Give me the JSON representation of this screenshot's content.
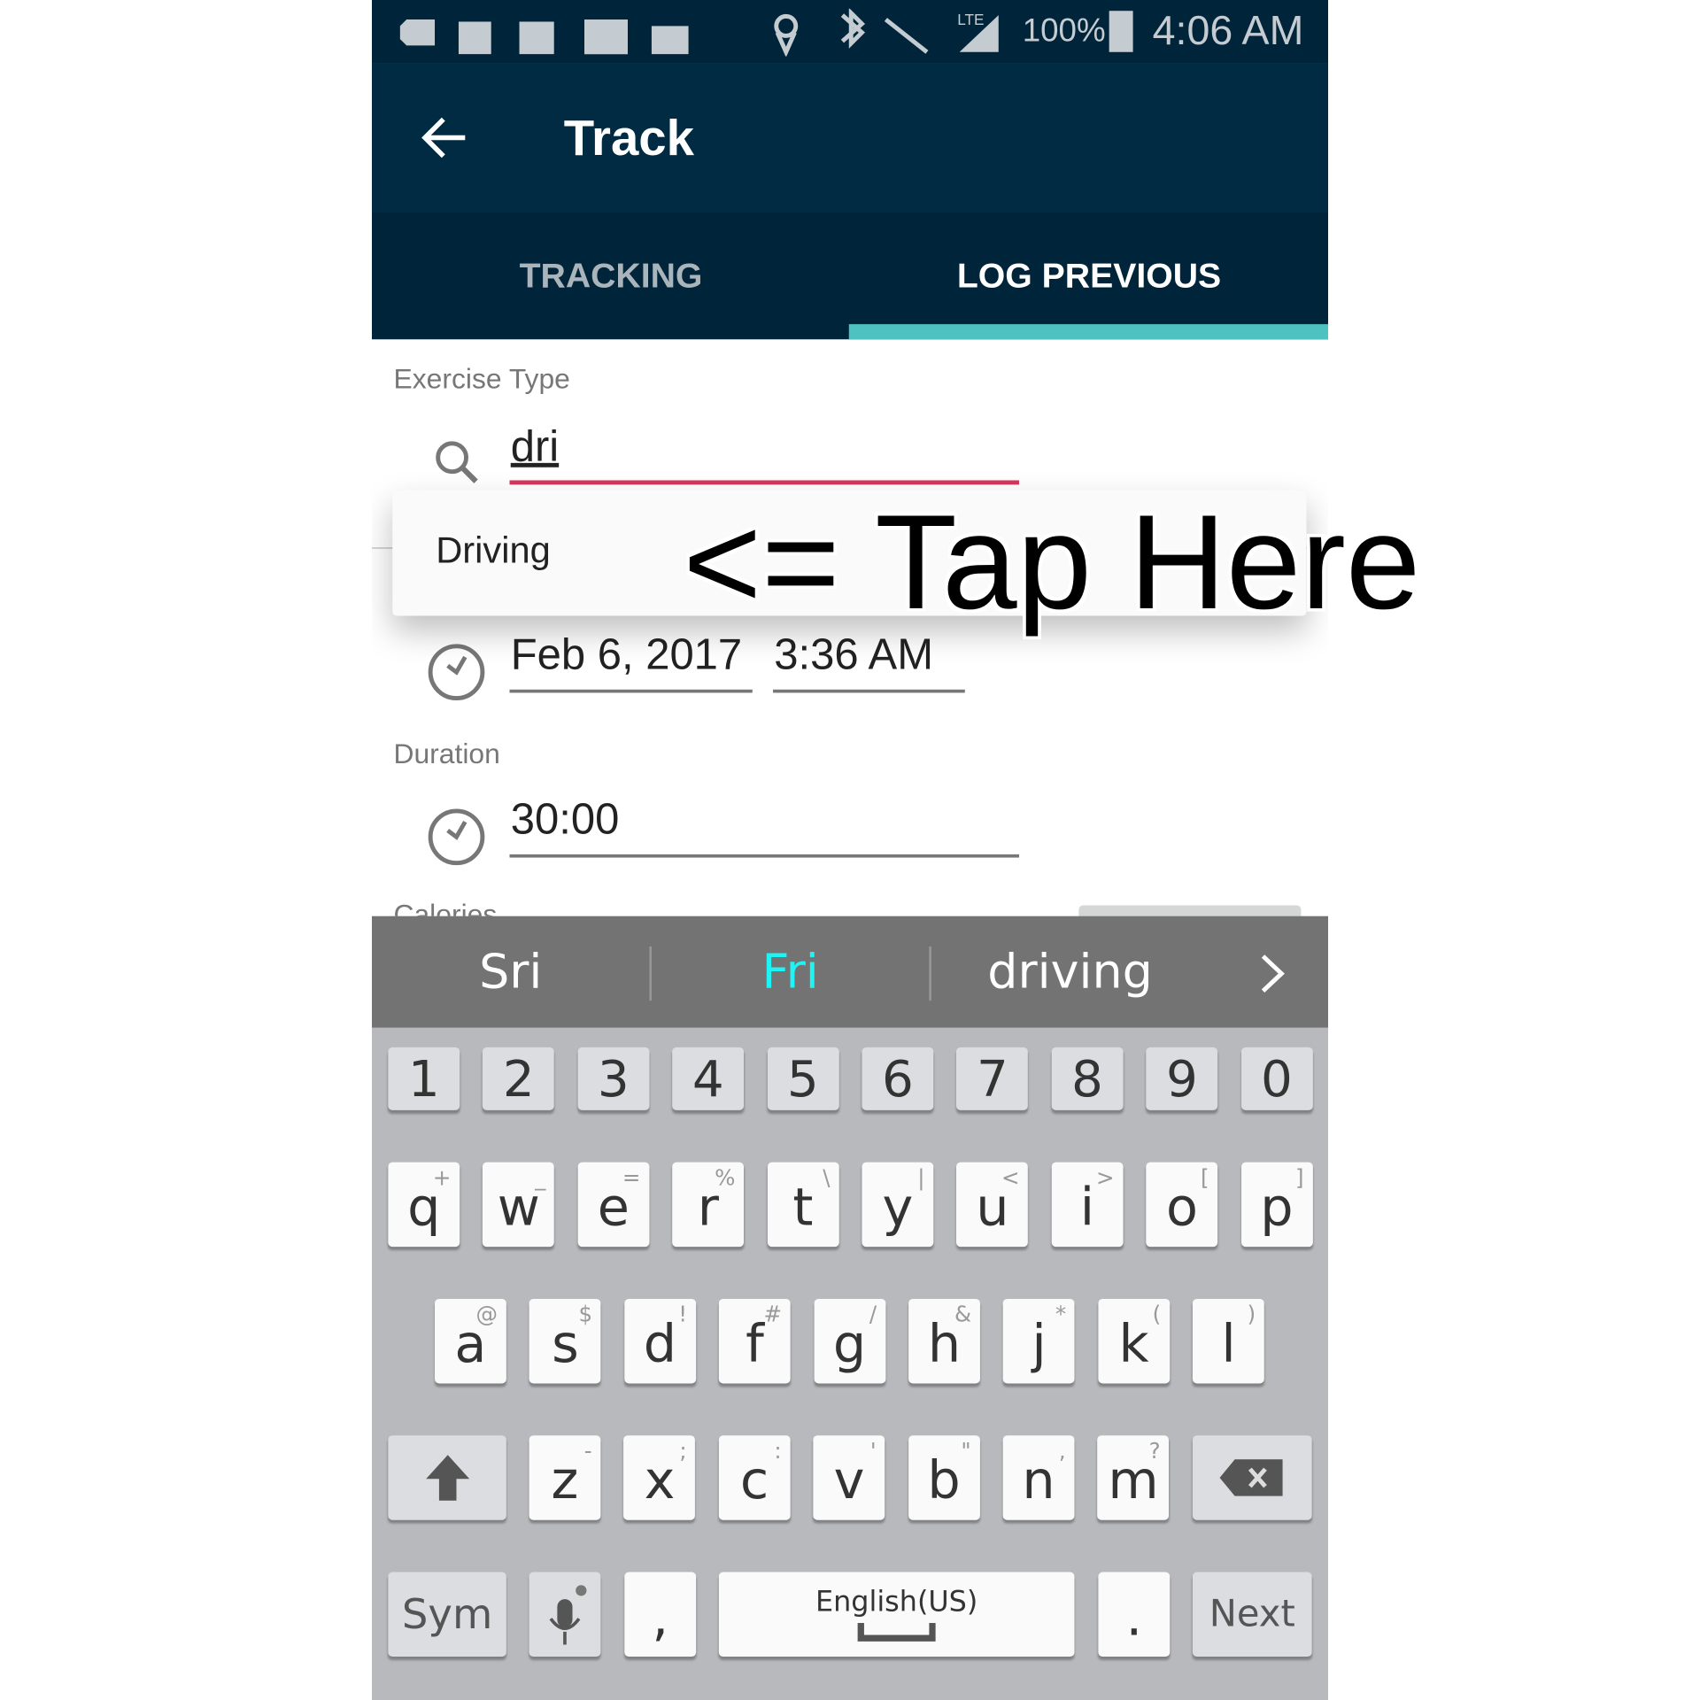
{
  "status_bar": {
    "icons": [
      "add-icon",
      "facebook-icon",
      "ifttt-icon",
      "flipboard-icon",
      "mail-check-icon",
      "location-icon",
      "bluetooth-icon",
      "vibrate-mute-icon",
      "lte-signal-icon",
      "battery-icon"
    ],
    "network": "LTE",
    "battery": "100%",
    "time": "4:06 AM"
  },
  "toolbar": {
    "title": "Track",
    "back_icon": "arrow-left-icon"
  },
  "tabs": [
    {
      "label": "TRACKING",
      "active": false
    },
    {
      "label": "LOG PREVIOUS",
      "active": true
    }
  ],
  "colors": {
    "header": "#002b42",
    "tab_indicator": "#4ec1c1",
    "input_focus": "#d6365d"
  },
  "form": {
    "exercise_type_label": "Exercise Type",
    "search_value": "dri",
    "suggestion": "Driving",
    "annotation": "<= Tap Here",
    "date": "Feb 6, 2017",
    "time": "3:36 AM",
    "duration_label": "Duration",
    "duration": "30:00",
    "calories_label": "Calories"
  },
  "keyboard": {
    "suggestions": [
      "Sri",
      "Fri",
      "driving"
    ],
    "numbers": [
      "1",
      "2",
      "3",
      "4",
      "5",
      "6",
      "7",
      "8",
      "9",
      "0"
    ],
    "row1": [
      [
        "q",
        "+"
      ],
      [
        "w",
        "_"
      ],
      [
        "e",
        "="
      ],
      [
        "r",
        "%"
      ],
      [
        "t",
        "\\"
      ],
      [
        "y",
        "|"
      ],
      [
        "u",
        "<"
      ],
      [
        "i",
        ">"
      ],
      [
        "o",
        "["
      ],
      [
        "p",
        "]"
      ]
    ],
    "row2": [
      [
        "a",
        "@"
      ],
      [
        "s",
        "$"
      ],
      [
        "d",
        "!"
      ],
      [
        "f",
        "#"
      ],
      [
        "g",
        "/"
      ],
      [
        "h",
        "&"
      ],
      [
        "j",
        "*"
      ],
      [
        "k",
        "("
      ],
      [
        "l",
        ")"
      ]
    ],
    "row3": [
      [
        "z",
        "-"
      ],
      [
        "x",
        ";"
      ],
      [
        "c",
        ":"
      ],
      [
        "v",
        "'"
      ],
      [
        "b",
        "\""
      ],
      [
        "n",
        ","
      ],
      [
        "m",
        "?"
      ]
    ],
    "sym": "Sym",
    "comma": ",",
    "space": "English(US)",
    "period": ".",
    "next": "Next"
  }
}
